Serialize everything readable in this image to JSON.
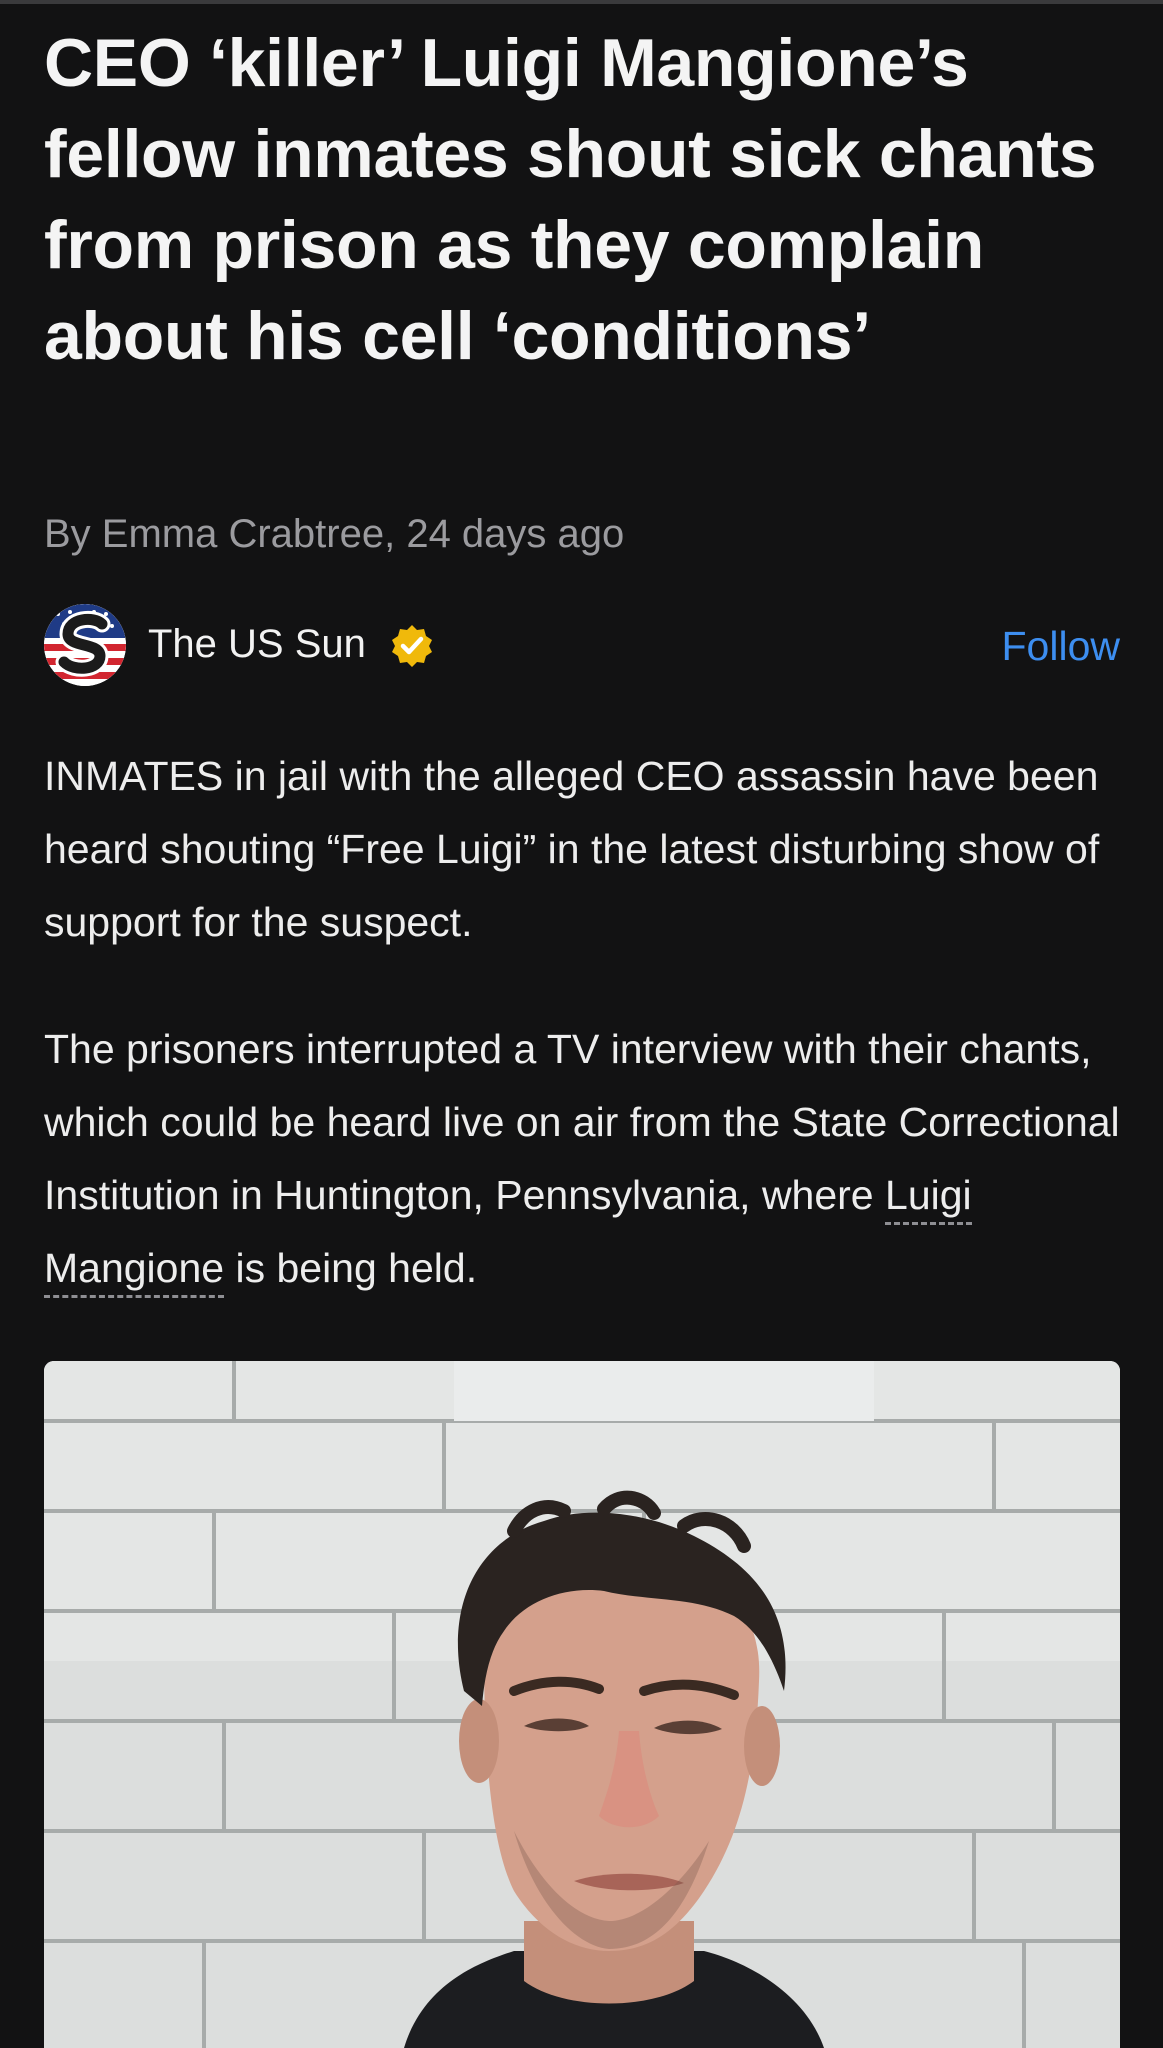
{
  "article": {
    "headline": "CEO ‘killer’ Luigi Mangione’s fellow inmates shout sick chants from prison as they complain about his cell ‘conditions’",
    "byline": "By Emma Crabtree, 24 days ago"
  },
  "source": {
    "name": "The US Sun",
    "logo_icon": "us-sun-logo-icon",
    "verified_icon": "verified-check-icon",
    "follow_label": "Follow"
  },
  "body": {
    "paragraph_1": "INMATES in jail with the alleged CEO assassin have been heard shouting “Free Luigi” in the latest disturbing show of support for the suspect.",
    "paragraph_2_before": "The prisoners interrupted a TV interview with their chants, which could be heard live on air from the State Correctional Institution in Huntington, Pennsylvania, where ",
    "paragraph_2_link": "Luigi Mangione",
    "paragraph_2_after": " is being held."
  },
  "colors": {
    "background": "#121213",
    "text": "#f2f2f2",
    "byline": "#9b9b9f",
    "accent": "#3d8ef0",
    "badge": "#f0b90b"
  }
}
